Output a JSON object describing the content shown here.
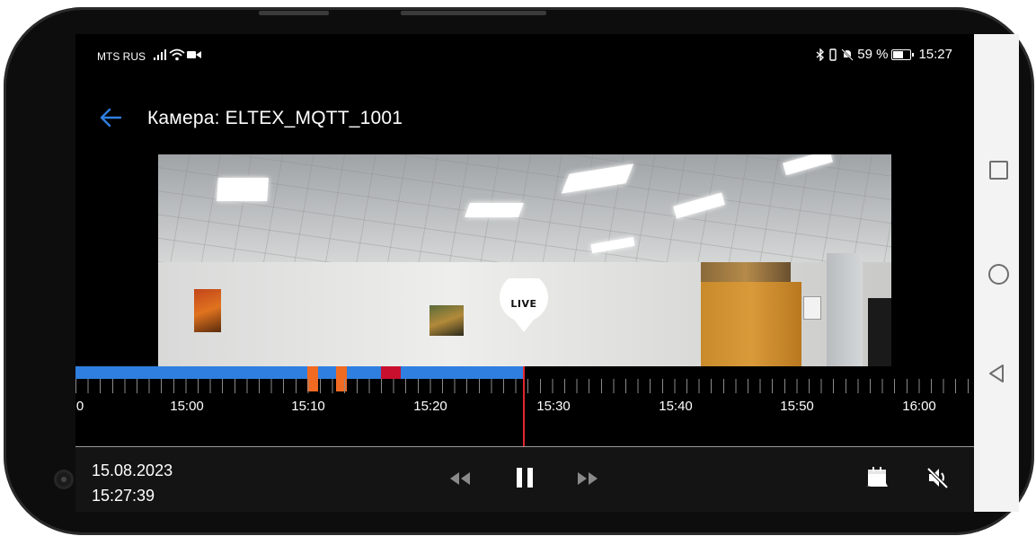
{
  "status_bar": {
    "carrier": "MTS RUS",
    "battery": "59 %",
    "time": "15:27",
    "icons": [
      "signal-icon",
      "wifi-icon",
      "video-icon",
      "bluetooth-icon",
      "vibrate-icon",
      "mute-icon",
      "battery-icon"
    ]
  },
  "header": {
    "title": "Камера: ELTEX_MQTT_1001",
    "back_icon": "back-arrow-icon"
  },
  "player": {
    "live_label": "LIVE",
    "date": "15.08.2023",
    "time": "15:27:39"
  },
  "timeline": {
    "tick_labels": [
      "0",
      "15:00",
      "15:10",
      "15:20",
      "15:30",
      "15:40",
      "15:50",
      "16:00"
    ],
    "recorded_color": "#2f7fe0",
    "event_color": "#f06a22",
    "alarm_color": "#c8102e",
    "playhead_color": "#e3262f"
  },
  "controls": {
    "icons": [
      "rewind-icon",
      "pause-icon",
      "fast-forward-icon",
      "calendar-icon",
      "sound-off-icon"
    ]
  },
  "nav_bar": {
    "icons": [
      "recent-apps-icon",
      "home-icon",
      "back-icon"
    ]
  }
}
